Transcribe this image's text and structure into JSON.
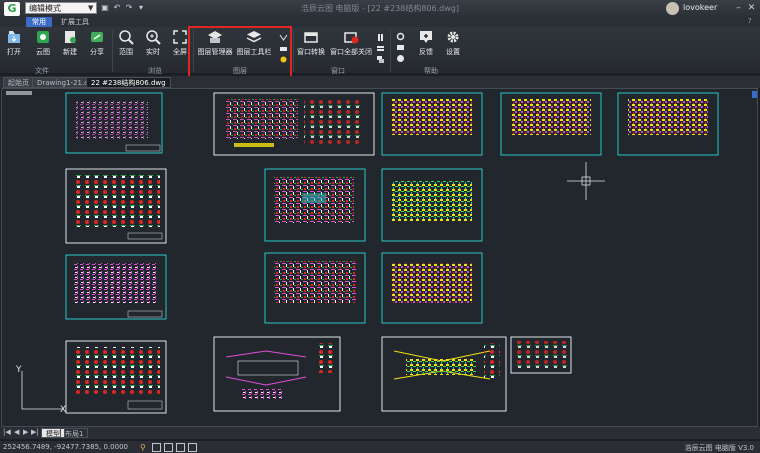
{
  "titlebar": {
    "mode_select": "编辑模式",
    "window_title": "浩辰云图 电脑版 - [22 #238结构806.dwg]",
    "user_name": "lovokeer"
  },
  "ribbon": {
    "tabs": [
      {
        "label": "常用",
        "active": true
      },
      {
        "label": "扩展工具",
        "active": false
      }
    ],
    "buttons": {
      "open": "打开",
      "cloud": "云图",
      "new": "新建",
      "share": "分享",
      "range": "范围",
      "realtime": "实时",
      "fullscreen": "全屏",
      "layer_manager": "图层管理器",
      "layer_toolbar": "图层工具栏",
      "window_convert": "窗口转换",
      "close_all": "窗口全部关闭",
      "feedback": "反馈",
      "settings": "设置"
    },
    "groups": {
      "file": "文件",
      "view": "浏览",
      "layer": "图层",
      "window": "窗口",
      "help": "帮助"
    }
  },
  "document_tabs": [
    {
      "label": "起始页",
      "active": false
    },
    {
      "label": "Drawing1-21.dwg",
      "active": false
    },
    {
      "label": "22 #238结构806.dwg",
      "active": true
    }
  ],
  "layout_tabs": [
    {
      "label": "模型",
      "active": true
    },
    {
      "label": "布局1",
      "active": false
    }
  ],
  "status": {
    "coordinates": "252456.7489, -92477.7385, 0.0000",
    "version": "浩辰云图 电脑版 V3.0"
  },
  "colors": {
    "accent_tab": "#3b6bc6",
    "highlight_box": "#e0261e",
    "sheet_border": "#25c8c8",
    "canvas_bg": "#22272e"
  }
}
